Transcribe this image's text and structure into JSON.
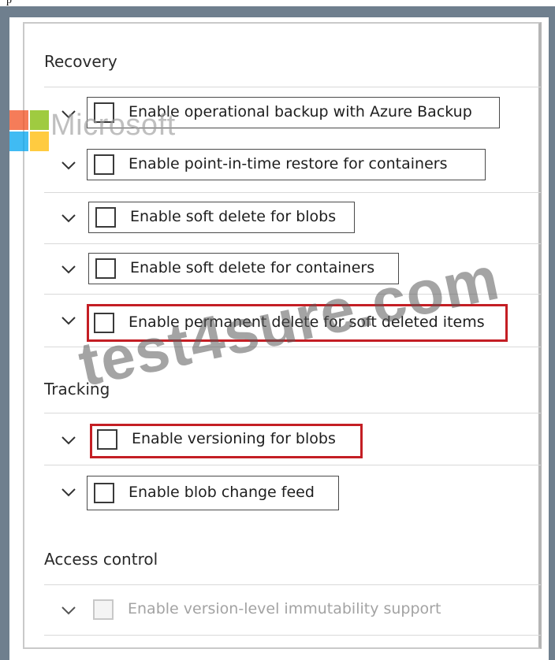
{
  "caption": "p",
  "sections": {
    "recovery": {
      "heading": "Recovery",
      "options": [
        {
          "label": "Enable operational backup with Azure Backup",
          "checked": false,
          "highlighted": false
        },
        {
          "label": "Enable point-in-time restore for containers",
          "checked": false,
          "highlighted": false
        },
        {
          "label": "Enable soft delete for blobs",
          "checked": false,
          "highlighted": false
        },
        {
          "label": "Enable soft delete for containers",
          "checked": false,
          "highlighted": false
        },
        {
          "label": "Enable permanent delete for soft deleted items",
          "checked": false,
          "highlighted": true
        }
      ]
    },
    "tracking": {
      "heading": "Tracking",
      "options": [
        {
          "label": "Enable versioning for blobs",
          "checked": false,
          "highlighted": true
        },
        {
          "label": "Enable blob change feed",
          "checked": false,
          "highlighted": false
        }
      ]
    },
    "access_control": {
      "heading": "Access control",
      "options": [
        {
          "label": "Enable version-level immutability support",
          "checked": false,
          "disabled": true
        }
      ]
    }
  },
  "watermarks": {
    "brand": "Microsoft",
    "site": "test4sure.com"
  },
  "colors": {
    "highlight": "#c41e24",
    "frame": "#6f7f8e",
    "ms_red": "#f25022",
    "ms_green": "#7fba00",
    "ms_blue": "#00a4ef",
    "ms_yellow": "#ffb900"
  },
  "icons": {
    "expand": "chevron-down-icon",
    "checkbox": "checkbox-empty"
  }
}
